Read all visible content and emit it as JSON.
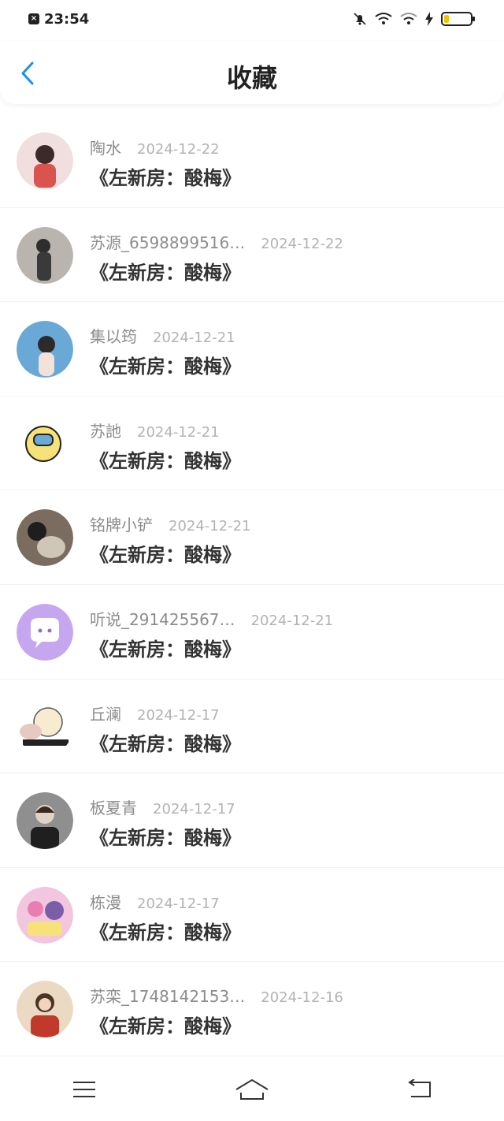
{
  "status": {
    "time": "23:54",
    "battery_color": "#f2c300"
  },
  "header": {
    "title": "收藏",
    "accent": "#1a8ef5"
  },
  "items": [
    {
      "user": "陶水",
      "date": "2024-12-22",
      "title": "《左新房：酸梅》"
    },
    {
      "user": "苏源_6598899516…",
      "date": "2024-12-22",
      "title": "《左新房：酸梅》"
    },
    {
      "user": "集以筠",
      "date": "2024-12-21",
      "title": "《左新房：酸梅》"
    },
    {
      "user": "苏訑",
      "date": "2024-12-21",
      "title": "《左新房：酸梅》"
    },
    {
      "user": "铭牌小铲",
      "date": "2024-12-21",
      "title": "《左新房：酸梅》"
    },
    {
      "user": "听说_291425567…",
      "date": "2024-12-21",
      "title": "《左新房：酸梅》"
    },
    {
      "user": "丘澜",
      "date": "2024-12-17",
      "title": "《左新房：酸梅》"
    },
    {
      "user": "板夏青",
      "date": "2024-12-17",
      "title": "《左新房：酸梅》"
    },
    {
      "user": "栋漫",
      "date": "2024-12-17",
      "title": "《左新房：酸梅》"
    },
    {
      "user": "苏栾_1748142153…",
      "date": "2024-12-16",
      "title": "《左新房：酸梅》"
    }
  ],
  "avatar_colors": [
    "#d9534f",
    "#5a5a5a",
    "#6aa9d6",
    "#f7e27a",
    "#7a6d5f",
    "#c7a6f0",
    "#f1e3c2",
    "#3b3b3b",
    "#e77fb3",
    "#c0392b"
  ],
  "nav": {
    "menu_icon": "menu-icon",
    "home_icon": "home-icon",
    "back_icon": "back-icon"
  }
}
